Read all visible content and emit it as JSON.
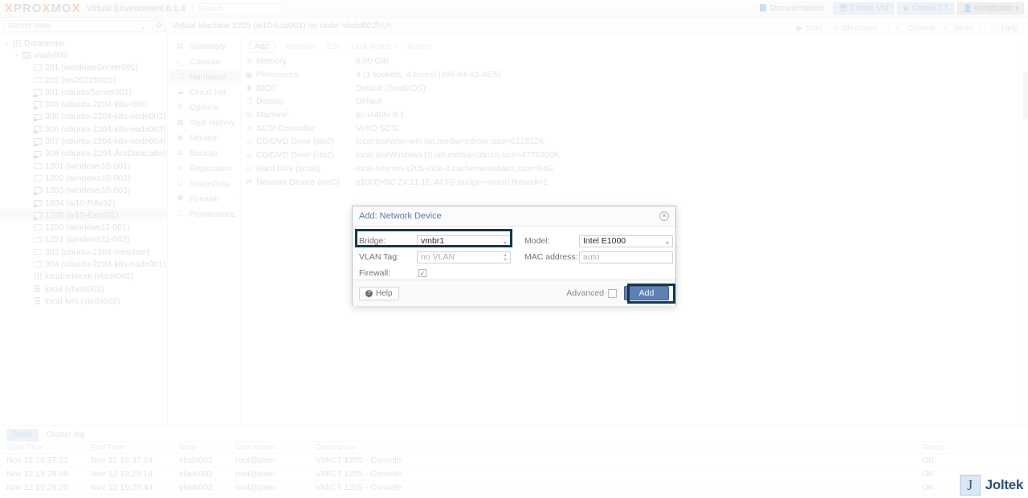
{
  "header": {
    "logo_left": "PRO",
    "logo_x1": "X",
    "logo_x2": "X",
    "logo_right": "MO",
    "product": "Virtual Environment 8.1.4",
    "search_placeholder": "Search",
    "buttons": [
      {
        "label": "Documentation",
        "icon": "book-icon",
        "style": "plain"
      },
      {
        "label": "Create VM",
        "icon": "monitor-icon",
        "style": "blue"
      },
      {
        "label": "Create CT",
        "icon": "container-icon",
        "style": "blue"
      },
      {
        "label": "root@pam",
        "icon": "user-icon",
        "style": "dark"
      }
    ]
  },
  "subbar": {
    "view_select": "Server View",
    "gear_icon": "gear-icon",
    "vm_title": "Virtual Machine 1205 (w10-Exp001) on node 'vlads002'",
    "tags_label": "No Tags",
    "edit_icon": "pencil-icon"
  },
  "vm_actions": [
    {
      "label": "Start",
      "icon": "play-icon"
    },
    {
      "label": "Shutdown",
      "icon": "power-icon"
    },
    {
      "label": "Console",
      "icon": "terminal-icon"
    },
    {
      "label": "More",
      "icon": ""
    },
    {
      "label": "Help",
      "icon": "help-icon"
    }
  ],
  "tree": {
    "items": [
      {
        "label": "Datacenter",
        "depth": 0,
        "icon": "datacenter-icon",
        "arrow": "▾",
        "selected": false
      },
      {
        "label": "vlads002",
        "depth": 1,
        "icon": "node-icon",
        "arrow": "▾",
        "selected": false
      },
      {
        "label": "201 (windowsServer001)",
        "depth": 2,
        "icon": "vm-stopped-icon",
        "arrow": "",
        "selected": false
      },
      {
        "label": "202 (ws2022S001)",
        "depth": 2,
        "icon": "vm-stopped-icon",
        "arrow": "",
        "selected": false
      },
      {
        "label": "301 (ubuntuServer001)",
        "depth": 2,
        "icon": "vm-running-icon",
        "arrow": "",
        "selected": false
      },
      {
        "label": "303 (ubuntu-2204-k8s-ctrlr)",
        "depth": 2,
        "icon": "vm-running-icon",
        "arrow": "",
        "selected": false
      },
      {
        "label": "305 (ubuntu-2204-k8s-node002)",
        "depth": 2,
        "icon": "vm-running-icon",
        "arrow": "",
        "selected": false
      },
      {
        "label": "306 (ubuntu-2204-k8s-node003)",
        "depth": 2,
        "icon": "vm-running-icon",
        "arrow": "",
        "selected": false
      },
      {
        "label": "307 (ubuntu-2204-k8s-node004)",
        "depth": 2,
        "icon": "vm-running-icon",
        "arrow": "",
        "selected": false
      },
      {
        "label": "308 (ubuntu-2204-ArcDataLabs)",
        "depth": 2,
        "icon": "vm-running-icon",
        "arrow": "",
        "selected": false
      },
      {
        "label": "1201 (windows10-001)",
        "depth": 2,
        "icon": "vm-stopped-icon",
        "arrow": "",
        "selected": false
      },
      {
        "label": "1202 (windows10-002)",
        "depth": 2,
        "icon": "vm-stopped-icon",
        "arrow": "",
        "selected": false
      },
      {
        "label": "1203 (windows10-003)",
        "depth": 2,
        "icon": "vm-running-icon",
        "arrow": "",
        "selected": false
      },
      {
        "label": "1204 (w10-RAv32)",
        "depth": 2,
        "icon": "vm-running-icon",
        "arrow": "",
        "selected": false
      },
      {
        "label": "1205 (w10-Exp001)",
        "depth": 2,
        "icon": "vm-running-icon",
        "arrow": "",
        "selected": true
      },
      {
        "label": "1250 (windows11-001)",
        "depth": 2,
        "icon": "vm-stopped-icon",
        "arrow": "",
        "selected": false
      },
      {
        "label": "1251 (windows11-002)",
        "depth": 2,
        "icon": "vm-stopped-icon",
        "arrow": "",
        "selected": false
      },
      {
        "label": "302 (ubuntu-2204-template)",
        "depth": 2,
        "icon": "template-icon",
        "arrow": "",
        "selected": false
      },
      {
        "label": "304 (ubuntu-2204-k8s-node001)",
        "depth": 2,
        "icon": "template-icon",
        "arrow": "",
        "selected": false
      },
      {
        "label": "localnetwork (vlads002)",
        "depth": 2,
        "icon": "network-icon",
        "arrow": "",
        "selected": false
      },
      {
        "label": "local (vlads002)",
        "depth": 2,
        "icon": "storage-icon",
        "arrow": "",
        "selected": false
      },
      {
        "label": "local-lvm (vlads002)",
        "depth": 2,
        "icon": "storage-icon",
        "arrow": "",
        "selected": false
      }
    ]
  },
  "subnav": {
    "items": [
      {
        "label": "Summary",
        "glyph": "▤",
        "icon": "summary-icon",
        "active": false,
        "arrow": ""
      },
      {
        "label": "Console",
        "glyph": ">_",
        "icon": "console-icon",
        "active": false,
        "arrow": ""
      },
      {
        "label": "Hardware",
        "glyph": "❐",
        "icon": "hardware-icon",
        "active": true,
        "arrow": ""
      },
      {
        "label": "Cloud-Init",
        "glyph": "☁",
        "icon": "cloud-init-icon",
        "active": false,
        "arrow": ""
      },
      {
        "label": "Options",
        "glyph": "⚙",
        "icon": "options-icon",
        "active": false,
        "arrow": ""
      },
      {
        "label": "Task History",
        "glyph": "▦",
        "icon": "task-history-icon",
        "active": false,
        "arrow": ""
      },
      {
        "label": "Monitor",
        "glyph": "◉",
        "icon": "monitor-icon",
        "active": false,
        "arrow": ""
      },
      {
        "label": "Backup",
        "glyph": "⧉",
        "icon": "backup-icon",
        "active": false,
        "arrow": ""
      },
      {
        "label": "Replication",
        "glyph": "↻",
        "icon": "replication-icon",
        "active": false,
        "arrow": ""
      },
      {
        "label": "Snapshots",
        "glyph": "↺",
        "icon": "snapshots-icon",
        "active": false,
        "arrow": ""
      },
      {
        "label": "Firewall",
        "glyph": "⛊",
        "icon": "firewall-icon",
        "active": false,
        "arrow": "›"
      },
      {
        "label": "Permissions",
        "glyph": "⚿",
        "icon": "permissions-icon",
        "active": false,
        "arrow": ""
      }
    ]
  },
  "hardware": {
    "toolbar": [
      {
        "label": "Add",
        "enabled": true,
        "caret": true
      },
      {
        "label": "Remove",
        "enabled": false,
        "caret": false
      },
      {
        "label": "Edit",
        "enabled": false,
        "caret": false
      },
      {
        "label": "Disk Action",
        "enabled": false,
        "caret": true
      },
      {
        "label": "Revert",
        "enabled": false,
        "caret": false
      }
    ],
    "rows": [
      {
        "glyph": "☰",
        "icon": "memory-icon",
        "key": "Memory",
        "value": "8.00 GiB"
      },
      {
        "glyph": "▣",
        "icon": "cpu-icon",
        "key": "Processors",
        "value": "4 (1 sockets, 4 cores) [x86-64-v2-AES]"
      },
      {
        "glyph": "▮",
        "icon": "bios-icon",
        "key": "BIOS",
        "value": "Default (SeaBIOS)"
      },
      {
        "glyph": "❐",
        "icon": "display-icon",
        "key": "Display",
        "value": "Default"
      },
      {
        "glyph": "⚙",
        "icon": "machine-icon",
        "key": "Machine",
        "value": "pc-i440fx-8.1"
      },
      {
        "glyph": "≡",
        "icon": "scsi-icon",
        "key": "SCSI Controller",
        "value": "VirtIO SCSI"
      },
      {
        "glyph": "◎",
        "icon": "cdrom-icon",
        "key": "CD/DVD Drive (ide0)",
        "value": "local:iso/virtio-win.iso,media=cdrom,size=612812K"
      },
      {
        "glyph": "◎",
        "icon": "cdrom-icon",
        "key": "CD/DVD Drive (ide2)",
        "value": "local:iso/Windows10.iso,media=cdrom,size=4779200K"
      },
      {
        "glyph": "◱",
        "icon": "harddisk-icon",
        "key": "Hard Disk (scsi0)",
        "value": "local-lvm:vm-1205-disk-0,cache=writeback,size=64G"
      },
      {
        "glyph": "⇄",
        "icon": "network-icon",
        "key": "Network Device (net0)",
        "value": "e1000=BC:24:11:1E:44:F0,bridge=vmbr0,firewall=1"
      }
    ]
  },
  "dialog": {
    "title": "Add: Network Device",
    "close_icon": "close-icon",
    "fields": {
      "bridge_label": "Bridge:",
      "bridge_value": "vmbr1",
      "vlan_label": "VLAN Tag:",
      "vlan_value": "no VLAN",
      "firewall_label": "Firewall:",
      "firewall_checked": "✓",
      "model_label": "Model:",
      "model_value": "Intel E1000",
      "mac_label": "MAC address:",
      "mac_value": "auto"
    },
    "footer": {
      "help_label": "Help",
      "advanced_label": "Advanced",
      "add_label": "Add"
    },
    "highlight_color": "#0e3a4f"
  },
  "tasks": {
    "tabs": [
      {
        "label": "Tasks",
        "active": true
      },
      {
        "label": "Cluster log",
        "active": false
      }
    ],
    "columns": [
      "Start Time ↓",
      "End Time",
      "Node",
      "User name",
      "Description",
      "Status"
    ],
    "rows": [
      {
        "start": "Nov 12 19:37:22",
        "end": "Nov 12 19:37:24",
        "node": "vlads002",
        "user": "root@pam",
        "desc": "VM/CT 1205 - Console",
        "status": "OK"
      },
      {
        "start": "Nov 12 19:28:46",
        "end": "Nov 12 19:29:14",
        "node": "vlads002",
        "user": "root@pam",
        "desc": "VM/CT 1205 - Console",
        "status": "OK"
      },
      {
        "start": "Nov 12 19:28:20",
        "end": "Nov 12 19:28:44",
        "node": "vlads002",
        "user": "root@pam",
        "desc": "VM/CT 1205 - Console",
        "status": "OK"
      }
    ]
  },
  "watermark": {
    "mark": "J",
    "text": "Joltek"
  }
}
